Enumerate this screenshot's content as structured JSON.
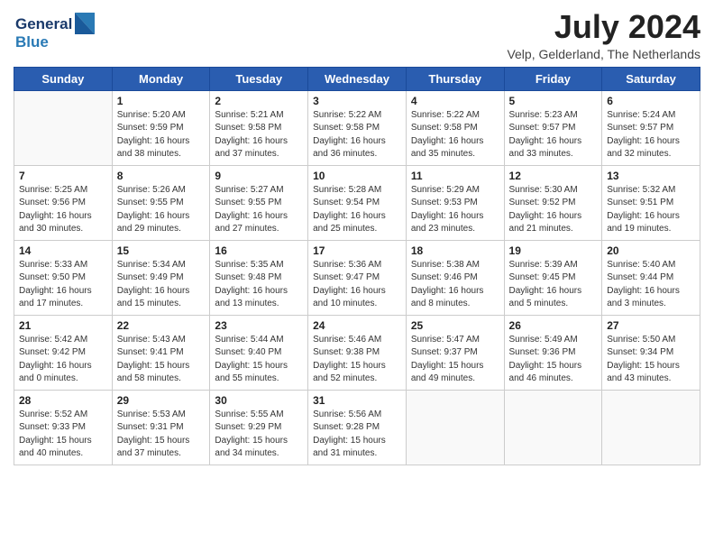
{
  "header": {
    "logo_line1": "General",
    "logo_line2": "Blue",
    "month_year": "July 2024",
    "location": "Velp, Gelderland, The Netherlands"
  },
  "weekdays": [
    "Sunday",
    "Monday",
    "Tuesday",
    "Wednesday",
    "Thursday",
    "Friday",
    "Saturday"
  ],
  "weeks": [
    [
      {
        "day": "",
        "info": ""
      },
      {
        "day": "1",
        "info": "Sunrise: 5:20 AM\nSunset: 9:59 PM\nDaylight: 16 hours\nand 38 minutes."
      },
      {
        "day": "2",
        "info": "Sunrise: 5:21 AM\nSunset: 9:58 PM\nDaylight: 16 hours\nand 37 minutes."
      },
      {
        "day": "3",
        "info": "Sunrise: 5:22 AM\nSunset: 9:58 PM\nDaylight: 16 hours\nand 36 minutes."
      },
      {
        "day": "4",
        "info": "Sunrise: 5:22 AM\nSunset: 9:58 PM\nDaylight: 16 hours\nand 35 minutes."
      },
      {
        "day": "5",
        "info": "Sunrise: 5:23 AM\nSunset: 9:57 PM\nDaylight: 16 hours\nand 33 minutes."
      },
      {
        "day": "6",
        "info": "Sunrise: 5:24 AM\nSunset: 9:57 PM\nDaylight: 16 hours\nand 32 minutes."
      }
    ],
    [
      {
        "day": "7",
        "info": "Sunrise: 5:25 AM\nSunset: 9:56 PM\nDaylight: 16 hours\nand 30 minutes."
      },
      {
        "day": "8",
        "info": "Sunrise: 5:26 AM\nSunset: 9:55 PM\nDaylight: 16 hours\nand 29 minutes."
      },
      {
        "day": "9",
        "info": "Sunrise: 5:27 AM\nSunset: 9:55 PM\nDaylight: 16 hours\nand 27 minutes."
      },
      {
        "day": "10",
        "info": "Sunrise: 5:28 AM\nSunset: 9:54 PM\nDaylight: 16 hours\nand 25 minutes."
      },
      {
        "day": "11",
        "info": "Sunrise: 5:29 AM\nSunset: 9:53 PM\nDaylight: 16 hours\nand 23 minutes."
      },
      {
        "day": "12",
        "info": "Sunrise: 5:30 AM\nSunset: 9:52 PM\nDaylight: 16 hours\nand 21 minutes."
      },
      {
        "day": "13",
        "info": "Sunrise: 5:32 AM\nSunset: 9:51 PM\nDaylight: 16 hours\nand 19 minutes."
      }
    ],
    [
      {
        "day": "14",
        "info": "Sunrise: 5:33 AM\nSunset: 9:50 PM\nDaylight: 16 hours\nand 17 minutes."
      },
      {
        "day": "15",
        "info": "Sunrise: 5:34 AM\nSunset: 9:49 PM\nDaylight: 16 hours\nand 15 minutes."
      },
      {
        "day": "16",
        "info": "Sunrise: 5:35 AM\nSunset: 9:48 PM\nDaylight: 16 hours\nand 13 minutes."
      },
      {
        "day": "17",
        "info": "Sunrise: 5:36 AM\nSunset: 9:47 PM\nDaylight: 16 hours\nand 10 minutes."
      },
      {
        "day": "18",
        "info": "Sunrise: 5:38 AM\nSunset: 9:46 PM\nDaylight: 16 hours\nand 8 minutes."
      },
      {
        "day": "19",
        "info": "Sunrise: 5:39 AM\nSunset: 9:45 PM\nDaylight: 16 hours\nand 5 minutes."
      },
      {
        "day": "20",
        "info": "Sunrise: 5:40 AM\nSunset: 9:44 PM\nDaylight: 16 hours\nand 3 minutes."
      }
    ],
    [
      {
        "day": "21",
        "info": "Sunrise: 5:42 AM\nSunset: 9:42 PM\nDaylight: 16 hours\nand 0 minutes."
      },
      {
        "day": "22",
        "info": "Sunrise: 5:43 AM\nSunset: 9:41 PM\nDaylight: 15 hours\nand 58 minutes."
      },
      {
        "day": "23",
        "info": "Sunrise: 5:44 AM\nSunset: 9:40 PM\nDaylight: 15 hours\nand 55 minutes."
      },
      {
        "day": "24",
        "info": "Sunrise: 5:46 AM\nSunset: 9:38 PM\nDaylight: 15 hours\nand 52 minutes."
      },
      {
        "day": "25",
        "info": "Sunrise: 5:47 AM\nSunset: 9:37 PM\nDaylight: 15 hours\nand 49 minutes."
      },
      {
        "day": "26",
        "info": "Sunrise: 5:49 AM\nSunset: 9:36 PM\nDaylight: 15 hours\nand 46 minutes."
      },
      {
        "day": "27",
        "info": "Sunrise: 5:50 AM\nSunset: 9:34 PM\nDaylight: 15 hours\nand 43 minutes."
      }
    ],
    [
      {
        "day": "28",
        "info": "Sunrise: 5:52 AM\nSunset: 9:33 PM\nDaylight: 15 hours\nand 40 minutes."
      },
      {
        "day": "29",
        "info": "Sunrise: 5:53 AM\nSunset: 9:31 PM\nDaylight: 15 hours\nand 37 minutes."
      },
      {
        "day": "30",
        "info": "Sunrise: 5:55 AM\nSunset: 9:29 PM\nDaylight: 15 hours\nand 34 minutes."
      },
      {
        "day": "31",
        "info": "Sunrise: 5:56 AM\nSunset: 9:28 PM\nDaylight: 15 hours\nand 31 minutes."
      },
      {
        "day": "",
        "info": ""
      },
      {
        "day": "",
        "info": ""
      },
      {
        "day": "",
        "info": ""
      }
    ]
  ]
}
